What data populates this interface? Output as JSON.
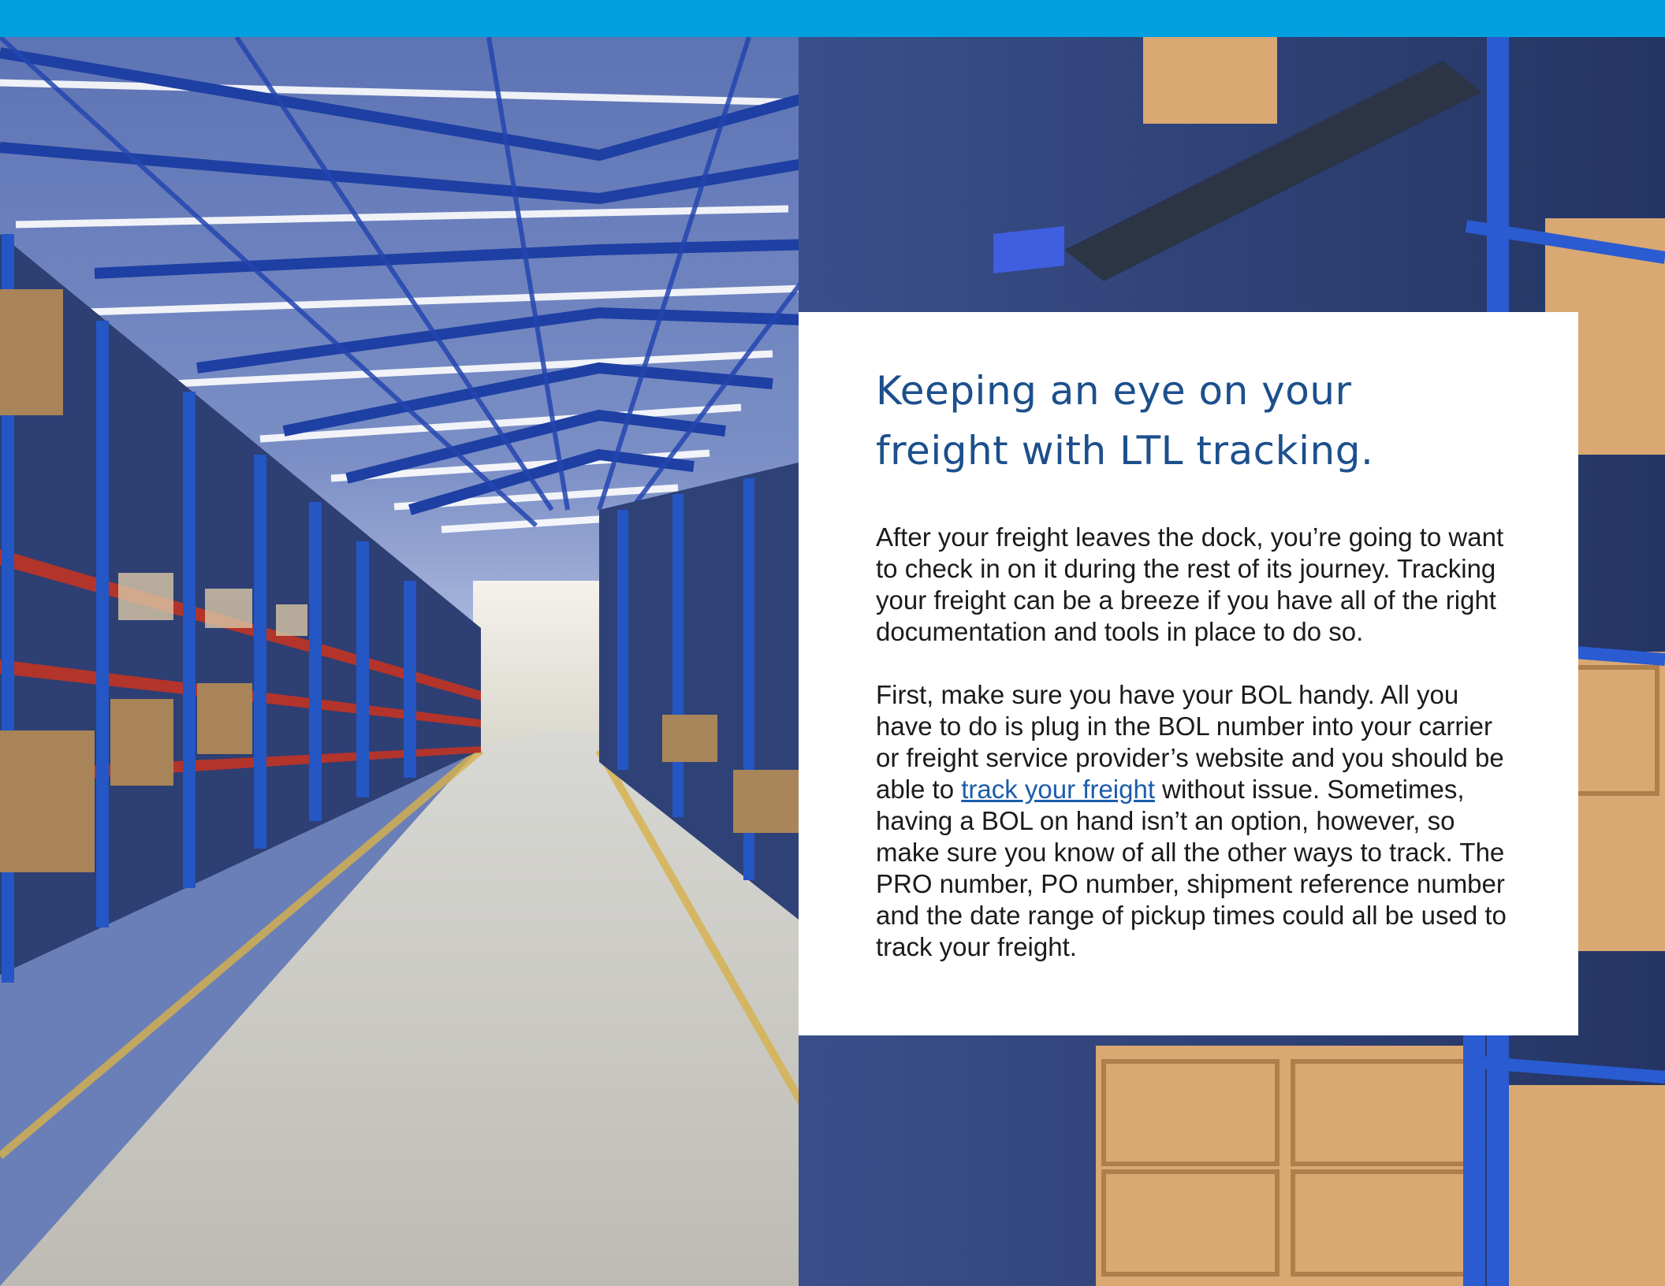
{
  "colors": {
    "top_bar": "#009fdf",
    "title": "#1c4f8c",
    "body_text": "#1b1b1b",
    "link": "#1c5cab",
    "card_background": "#ffffff"
  },
  "background_image": {
    "subject": "warehouse-interior-photo"
  },
  "article": {
    "title_line_1": "Keeping an eye on your",
    "title_line_2": "freight with LTL tracking.",
    "paragraph_1": "After your freight leaves the dock, you’re going to want to check in on it during the rest of its journey. Tracking your freight can be a breeze if you have all of the right documentation and tools in place to do so.",
    "paragraph_2_before_link": "First, make sure you have your BOL handy. All you have to do is plug in the BOL number into your carrier or freight service provider’s website and you should be able to ",
    "link_text": "track your freight",
    "paragraph_2_after_link": " without issue. Sometimes, having a BOL on hand isn’t an option, however, so make sure you know of all the other ways to track. The PRO number, PO number, shipment reference number and the date range of pickup times could all be used to track your freight."
  }
}
